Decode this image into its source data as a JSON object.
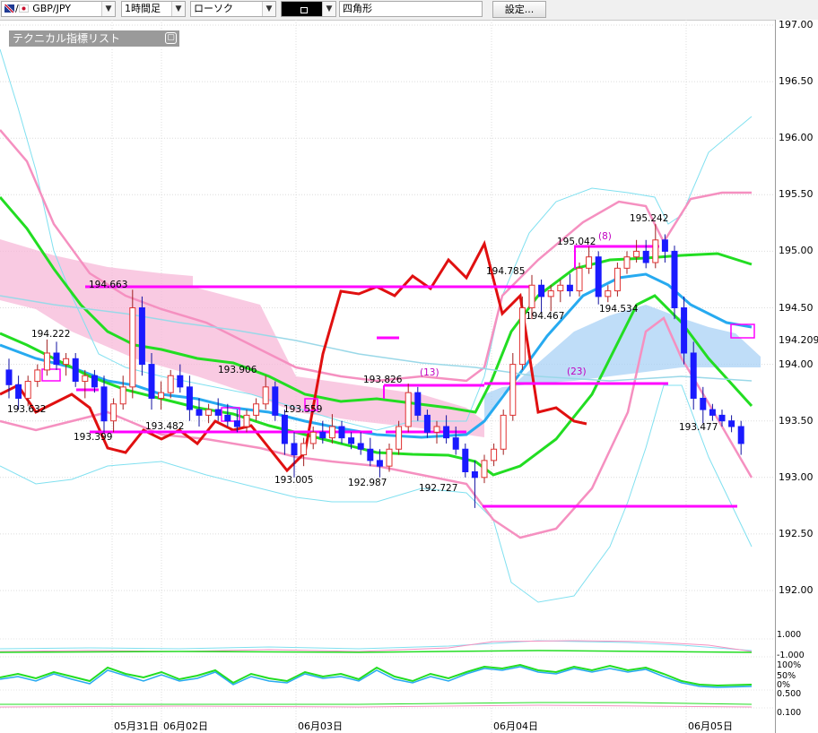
{
  "toolbar": {
    "symbol": "GBP/JPY",
    "timeframe": "1時間足",
    "chart_type": "ローソク",
    "drawing_tool": "",
    "shape_name": "四角形",
    "settings_button": "設定..."
  },
  "indicator_panel": {
    "title": "テクニカル指標リスト"
  },
  "price_axis": [
    "197.00",
    "196.50",
    "196.00",
    "195.50",
    "195.00",
    "194.50",
    "194.00",
    "193.50",
    "193.00",
    "192.50",
    "192.00"
  ],
  "sub_axis_a": [
    "1.000",
    "-1.000"
  ],
  "sub_axis_b": [
    "100%",
    "50%",
    "0%"
  ],
  "sub_axis_c": [
    "0.500",
    "0.100"
  ],
  "current_price_label": "194.209",
  "date_labels": [
    "05月31日",
    "06月02日",
    "06月03日",
    "06月04日",
    "06月05日"
  ],
  "price_annotations": [
    "194.663",
    "194.222",
    "193.632",
    "193.399",
    "193.482",
    "193.906",
    "193.559",
    "193.005",
    "193.826",
    "192.987",
    "192.727",
    "194.785",
    "194.467",
    "195.042",
    "195.242",
    "194.534",
    "193.477"
  ],
  "period_labels": [
    "(13)",
    "(23)",
    "(8)"
  ],
  "colors": {
    "bull": "#e03030",
    "bear": "#1a1aff",
    "ma_fast": "#22dd22",
    "ma_mid": "#27aaf0",
    "ma_slow": "#80e0f0",
    "bb": "#f590c0",
    "bb2": "#8fe8ff",
    "chikou": "#e01010",
    "levels": "#ff00ff",
    "cloud_pink": "#f7b8d8",
    "cloud_blue": "#a9d2f5"
  },
  "chart_data": {
    "type": "candlestick",
    "symbol": "GBP/JPY",
    "timeframe": "1時間足",
    "ylim": [
      191.95,
      197.0
    ],
    "x_labels": [
      "05月31日",
      "06月02日",
      "06月03日",
      "06月04日",
      "06月05日"
    ],
    "annotated_prices": [
      194.663,
      194.222,
      193.632,
      193.399,
      193.482,
      193.906,
      193.559,
      193.005,
      193.826,
      192.987,
      192.727,
      194.785,
      194.467,
      195.042,
      195.242,
      194.534,
      193.477
    ],
    "last_price": 194.209,
    "horizontal_levels": [
      194.663,
      193.826,
      193.399,
      192.727
    ],
    "candles": [
      [
        193.95,
        194.05,
        193.7,
        193.82
      ],
      [
        193.82,
        193.9,
        193.6,
        193.7
      ],
      [
        193.7,
        193.9,
        193.63,
        193.85
      ],
      [
        193.85,
        194.0,
        193.8,
        193.95
      ],
      [
        193.95,
        194.22,
        193.9,
        194.1
      ],
      [
        194.1,
        194.2,
        193.95,
        194.0
      ],
      [
        194.0,
        194.1,
        193.9,
        194.05
      ],
      [
        194.05,
        194.1,
        193.8,
        193.85
      ],
      [
        193.85,
        193.95,
        193.7,
        193.9
      ],
      [
        193.9,
        193.95,
        193.75,
        193.8
      ],
      [
        193.8,
        193.9,
        193.4,
        193.5
      ],
      [
        193.5,
        193.7,
        193.4,
        193.65
      ],
      [
        193.65,
        193.9,
        193.6,
        193.8
      ],
      [
        193.8,
        194.66,
        193.7,
        194.5
      ],
      [
        194.5,
        194.6,
        193.9,
        194.0
      ],
      [
        194.0,
        194.1,
        193.6,
        193.7
      ],
      [
        193.7,
        193.85,
        193.6,
        193.75
      ],
      [
        193.75,
        193.95,
        193.7,
        193.9
      ],
      [
        193.9,
        194.0,
        193.75,
        193.8
      ],
      [
        193.8,
        193.9,
        193.5,
        193.6
      ],
      [
        193.6,
        193.7,
        193.45,
        193.55
      ],
      [
        193.55,
        193.65,
        193.48,
        193.6
      ],
      [
        193.6,
        193.7,
        193.5,
        193.55
      ],
      [
        193.55,
        193.65,
        193.45,
        193.5
      ],
      [
        193.5,
        193.6,
        193.4,
        193.45
      ],
      [
        193.45,
        193.6,
        193.4,
        193.55
      ],
      [
        193.55,
        193.7,
        193.5,
        193.65
      ],
      [
        193.65,
        193.9,
        193.6,
        193.8
      ],
      [
        193.8,
        193.85,
        193.5,
        193.55
      ],
      [
        193.55,
        193.6,
        193.2,
        193.3
      ],
      [
        193.3,
        193.4,
        193.0,
        193.2
      ],
      [
        193.2,
        193.35,
        193.1,
        193.3
      ],
      [
        193.3,
        193.45,
        193.25,
        193.4
      ],
      [
        193.4,
        193.5,
        193.3,
        193.35
      ],
      [
        193.35,
        193.56,
        193.3,
        193.45
      ],
      [
        193.45,
        193.5,
        193.3,
        193.35
      ],
      [
        193.35,
        193.4,
        193.25,
        193.3
      ],
      [
        193.3,
        193.4,
        193.2,
        193.25
      ],
      [
        193.25,
        193.35,
        193.1,
        193.15
      ],
      [
        193.15,
        193.25,
        193.0,
        193.1
      ],
      [
        193.1,
        193.3,
        193.05,
        193.25
      ],
      [
        193.25,
        193.5,
        193.2,
        193.45
      ],
      [
        193.45,
        193.83,
        193.4,
        193.75
      ],
      [
        193.75,
        193.8,
        193.5,
        193.55
      ],
      [
        193.55,
        193.6,
        193.35,
        193.4
      ],
      [
        193.4,
        193.5,
        193.3,
        193.45
      ],
      [
        193.45,
        193.55,
        193.3,
        193.35
      ],
      [
        193.35,
        193.45,
        193.2,
        193.25
      ],
      [
        193.25,
        193.3,
        193.0,
        193.05
      ],
      [
        193.05,
        193.15,
        192.73,
        193.0
      ],
      [
        193.0,
        193.2,
        192.95,
        193.15
      ],
      [
        193.15,
        193.3,
        193.1,
        193.25
      ],
      [
        193.25,
        193.6,
        193.2,
        193.55
      ],
      [
        193.55,
        194.1,
        193.5,
        194.0
      ],
      [
        194.0,
        194.6,
        193.95,
        194.5
      ],
      [
        194.5,
        194.79,
        194.4,
        194.7
      ],
      [
        194.7,
        194.75,
        194.45,
        194.6
      ],
      [
        194.6,
        194.7,
        194.47,
        194.65
      ],
      [
        194.65,
        194.75,
        194.55,
        194.7
      ],
      [
        194.7,
        194.8,
        194.6,
        194.65
      ],
      [
        194.65,
        194.9,
        194.6,
        194.85
      ],
      [
        194.85,
        195.04,
        194.8,
        194.95
      ],
      [
        194.95,
        195.0,
        194.53,
        194.6
      ],
      [
        194.6,
        194.7,
        194.55,
        194.65
      ],
      [
        194.65,
        194.9,
        194.6,
        194.85
      ],
      [
        194.85,
        195.0,
        194.8,
        194.95
      ],
      [
        194.95,
        195.1,
        194.9,
        195.0
      ],
      [
        195.0,
        195.1,
        194.85,
        194.9
      ],
      [
        194.9,
        195.24,
        194.85,
        195.1
      ],
      [
        195.1,
        195.15,
        194.9,
        195.0
      ],
      [
        195.0,
        195.05,
        194.4,
        194.5
      ],
      [
        194.5,
        194.6,
        194.0,
        194.1
      ],
      [
        194.1,
        194.2,
        193.6,
        193.7
      ],
      [
        193.7,
        193.8,
        193.48,
        193.6
      ],
      [
        193.6,
        193.65,
        193.5,
        193.55
      ],
      [
        193.55,
        193.6,
        193.45,
        193.5
      ],
      [
        193.5,
        193.55,
        193.4,
        193.45
      ],
      [
        193.45,
        193.5,
        193.2,
        193.3
      ]
    ]
  }
}
